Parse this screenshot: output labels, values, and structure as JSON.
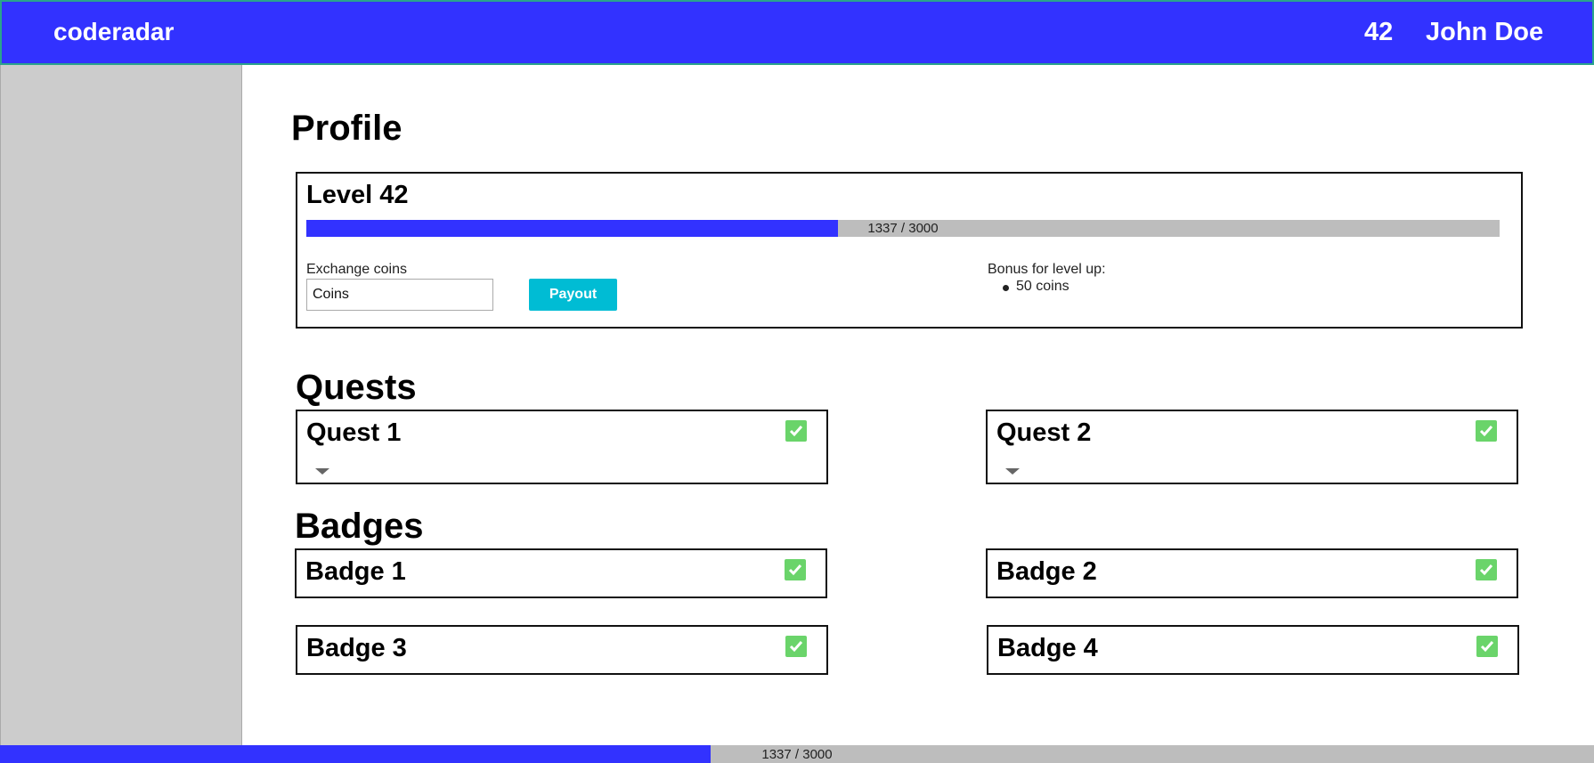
{
  "header": {
    "brand": "coderadar",
    "level": "42",
    "username": "John Doe"
  },
  "profile": {
    "title": "Profile",
    "level_title": "Level 42",
    "progress": {
      "current": 1337,
      "max": 3000,
      "text": "1337 / 3000"
    },
    "exchange_label": "Exchange coins",
    "coins_placeholder": "Coins",
    "payout_label": "Payout",
    "bonus_label": "Bonus for level up:",
    "bonus_items": [
      "50 coins"
    ]
  },
  "quests": {
    "title": "Quests",
    "items": [
      {
        "title": "Quest 1",
        "completed": true
      },
      {
        "title": "Quest 2",
        "completed": true
      }
    ]
  },
  "badges": {
    "title": "Badges",
    "items": [
      {
        "title": "Badge 1",
        "completed": true
      },
      {
        "title": "Badge 2",
        "completed": true
      },
      {
        "title": "Badge 3",
        "completed": true
      },
      {
        "title": "Badge 4",
        "completed": true
      }
    ]
  },
  "footer_progress": {
    "current": 1337,
    "max": 3000,
    "text": "1337 / 3000"
  },
  "colors": {
    "primary": "#3232ff",
    "accent": "#00bcd4",
    "check": "#6ad46a",
    "sidebar": "#cccccc",
    "track": "#bdbdbd"
  },
  "icons": {
    "completed": "check-icon",
    "expand": "caret-down-icon"
  }
}
